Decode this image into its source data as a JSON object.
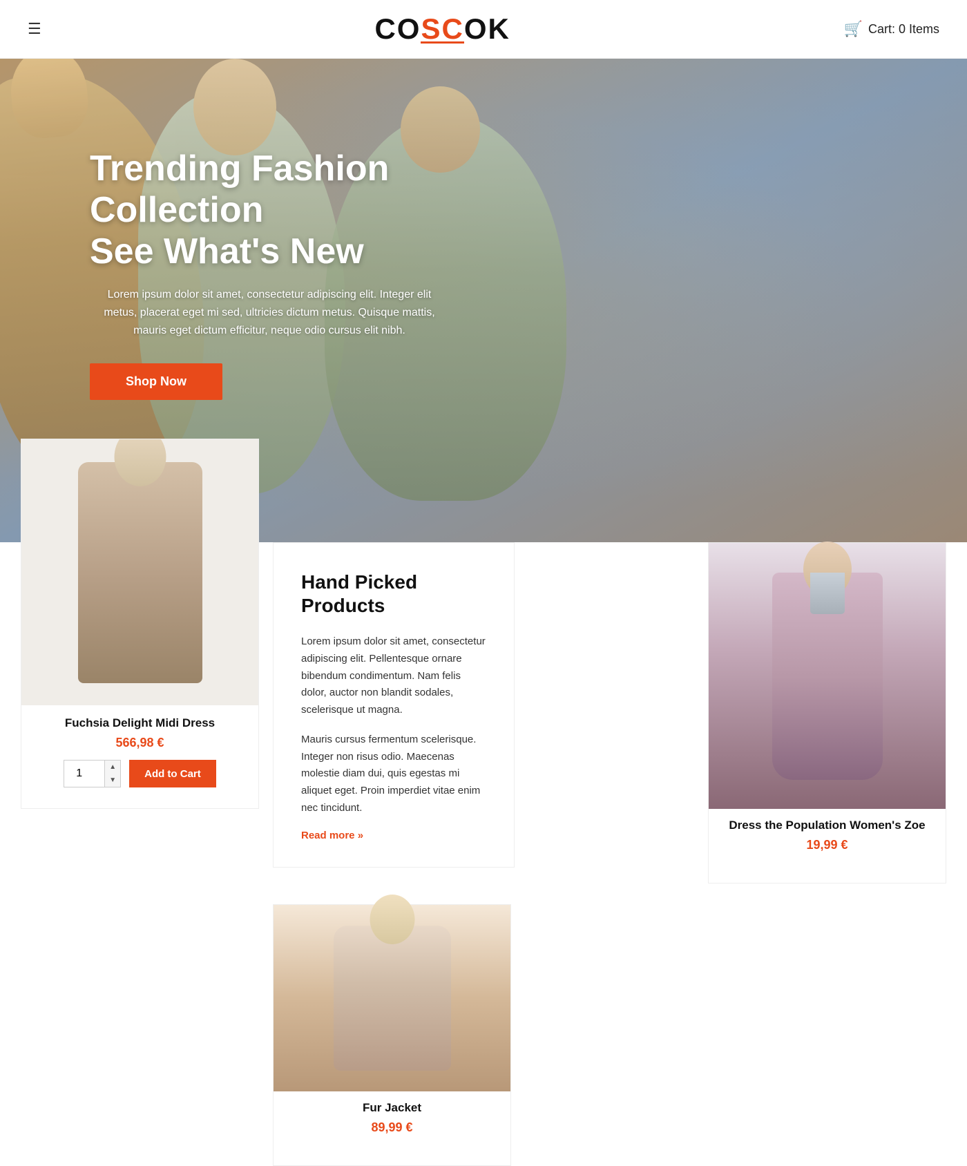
{
  "header": {
    "logo_part1": "CO",
    "logo_highlight": "SC",
    "logo_part2": "OK",
    "cart_label": "Cart: 0 Items",
    "menu_icon": "☰",
    "cart_icon": "🛍"
  },
  "hero": {
    "title_line1": "Trending Fashion",
    "title_line2": "Collection",
    "title_line3": "See What's New",
    "description": "Lorem ipsum dolor sit amet, consectetur adipiscing elit. Integer elit metus, placerat eget mi sed, ultricies dictum metus. Quisque mattis, mauris eget dictum efficitur, neque odio cursus elit nibh.",
    "cta_button": "Shop Now"
  },
  "info_card": {
    "title": "Hand Picked Products",
    "text1": "Lorem ipsum dolor sit amet, consectetur adipiscing elit. Pellentesque ornare bibendum condimentum. Nam felis dolor, auctor non blandit sodales, scelerisque ut magna.",
    "text2": "Mauris cursus fermentum scelerisque. Integer non risus odio. Maecenas molestie diam dui, quis egestas mi aliquet eget. Proin imperdiet vitae enim nec tincidunt.",
    "read_more": "Read more »"
  },
  "product1": {
    "name": "Fuchsia Delight Midi Dress",
    "price": "566,98 €",
    "qty": "1",
    "add_to_cart": "Add to Cart"
  },
  "product2": {
    "name": "Dress the Population Women's Zoe",
    "price": "19,99 €"
  },
  "product3": {
    "name": "Fur Jacket",
    "price": "89,99 €"
  }
}
